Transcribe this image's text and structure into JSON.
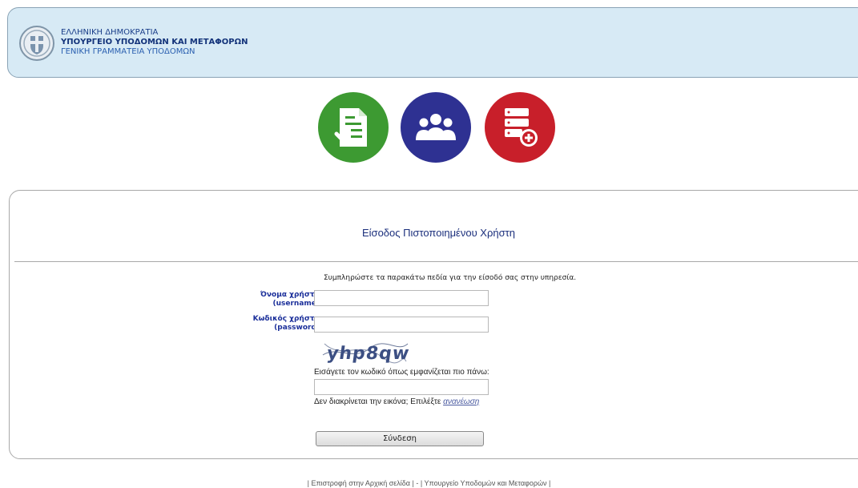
{
  "header": {
    "line1": "ΕΛΛΗΝΙΚΗ ΔΗΜΟΚΡΑΤΙΑ",
    "line2": "ΥΠΟΥΡΓΕΙΟ ΥΠΟΔΟΜΩΝ ΚΑΙ ΜΕΤΑΦΟΡΩΝ",
    "line3": "ΓΕΝΙΚΗ ΓΡΑΜΜΑΤΕΙΑ ΥΠΟΔΟΜΩΝ",
    "logo_icon": "greek-coat-of-arms-icon"
  },
  "app_icons": [
    {
      "icon": "document-check-icon",
      "color": "#3d9a32"
    },
    {
      "icon": "users-group-icon",
      "color": "#2e3192"
    },
    {
      "icon": "database-add-icon",
      "color": "#c81f2a"
    }
  ],
  "login": {
    "title": "Είσοδος Πιστοποιημένου Χρήστη",
    "instructions": "Συμπληρώστε τα παρακάτω πεδία για την είσοδό σας στην υπηρεσία.",
    "username_label": "Όνομα χρήστη",
    "username_sub": "(username)",
    "username_value": "",
    "password_label": "Κωδικός χρήστη",
    "password_sub": "(password)",
    "password_value": "",
    "captcha_text": "yhp8qw",
    "captcha_hint": "Εισάγετε τον κωδικό όπως εμφανίζεται πιο πάνω:",
    "captcha_value": "",
    "refresh_prefix": "Δεν διακρίνεται την εικόνα; Επιλέξτε ",
    "refresh_link": "ανανέωση",
    "submit_label": "Σύνδεση"
  },
  "footer": {
    "open": "| ",
    "home_link": "Επιστροφή στην Αρχική σελίδα",
    "separator": " | - | ",
    "ministry_link": "Υπουργείο Υποδομών και Μεταφορών",
    "close": " |"
  },
  "colors": {
    "header_bg": "#d7eaf5",
    "title_blue": "#1b2f7c",
    "label_blue": "#1b2f9a"
  }
}
